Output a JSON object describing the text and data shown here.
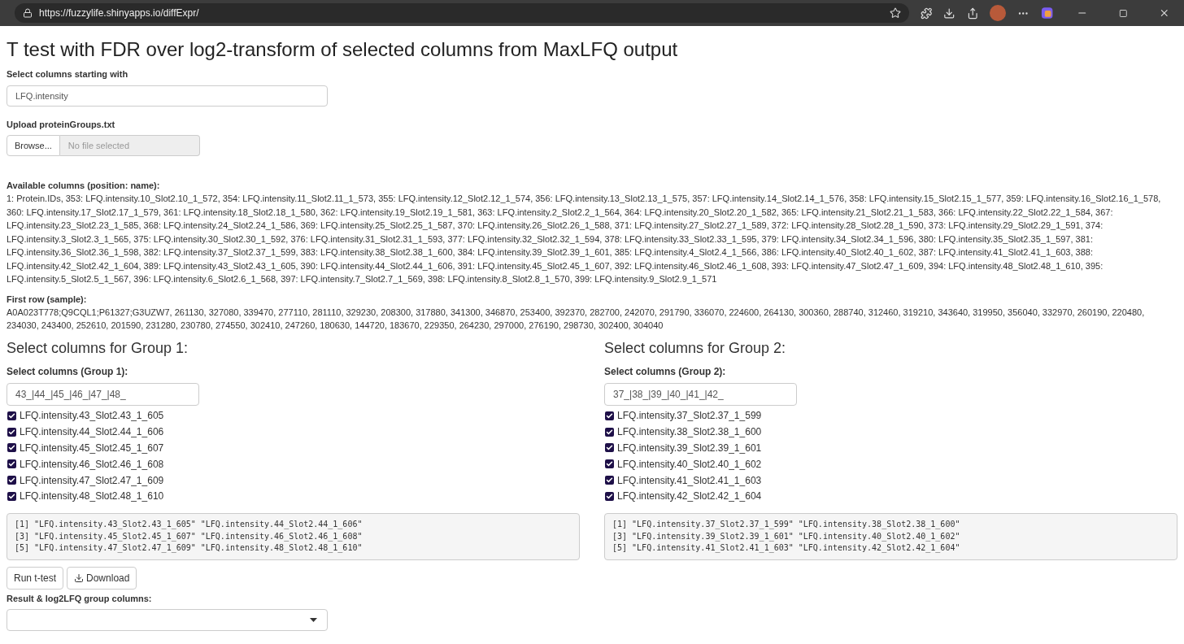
{
  "browser": {
    "url": "https://fuzzylife.shinyapps.io/diffExpr/"
  },
  "title": "T test with FDR over log2-transform of selected columns from MaxLFQ output",
  "prefix_field": {
    "label": "Select columns starting with",
    "value": "LFQ.intensity"
  },
  "upload": {
    "label": "Upload proteinGroups.txt",
    "button": "Browse...",
    "placeholder": "No file selected"
  },
  "available": {
    "heading": "Available columns (position: name):",
    "text": "1: Protein.IDs, 353: LFQ.intensity.10_Slot2.10_1_572, 354: LFQ.intensity.11_Slot2.11_1_573, 355: LFQ.intensity.12_Slot2.12_1_574, 356: LFQ.intensity.13_Slot2.13_1_575, 357: LFQ.intensity.14_Slot2.14_1_576, 358: LFQ.intensity.15_Slot2.15_1_577, 359: LFQ.intensity.16_Slot2.16_1_578, 360: LFQ.intensity.17_Slot2.17_1_579, 361: LFQ.intensity.18_Slot2.18_1_580, 362: LFQ.intensity.19_Slot2.19_1_581, 363: LFQ.intensity.2_Slot2.2_1_564, 364: LFQ.intensity.20_Slot2.20_1_582, 365: LFQ.intensity.21_Slot2.21_1_583, 366: LFQ.intensity.22_Slot2.22_1_584, 367: LFQ.intensity.23_Slot2.23_1_585, 368: LFQ.intensity.24_Slot2.24_1_586, 369: LFQ.intensity.25_Slot2.25_1_587, 370: LFQ.intensity.26_Slot2.26_1_588, 371: LFQ.intensity.27_Slot2.27_1_589, 372: LFQ.intensity.28_Slot2.28_1_590, 373: LFQ.intensity.29_Slot2.29_1_591, 374: LFQ.intensity.3_Slot2.3_1_565, 375: LFQ.intensity.30_Slot2.30_1_592, 376: LFQ.intensity.31_Slot2.31_1_593, 377: LFQ.intensity.32_Slot2.32_1_594, 378: LFQ.intensity.33_Slot2.33_1_595, 379: LFQ.intensity.34_Slot2.34_1_596, 380: LFQ.intensity.35_Slot2.35_1_597, 381: LFQ.intensity.36_Slot2.36_1_598, 382: LFQ.intensity.37_Slot2.37_1_599, 383: LFQ.intensity.38_Slot2.38_1_600, 384: LFQ.intensity.39_Slot2.39_1_601, 385: LFQ.intensity.4_Slot2.4_1_566, 386: LFQ.intensity.40_Slot2.40_1_602, 387: LFQ.intensity.41_Slot2.41_1_603, 388: LFQ.intensity.42_Slot2.42_1_604, 389: LFQ.intensity.43_Slot2.43_1_605, 390: LFQ.intensity.44_Slot2.44_1_606, 391: LFQ.intensity.45_Slot2.45_1_607, 392: LFQ.intensity.46_Slot2.46_1_608, 393: LFQ.intensity.47_Slot2.47_1_609, 394: LFQ.intensity.48_Slot2.48_1_610, 395: LFQ.intensity.5_Slot2.5_1_567, 396: LFQ.intensity.6_Slot2.6_1_568, 397: LFQ.intensity.7_Slot2.7_1_569, 398: LFQ.intensity.8_Slot2.8_1_570, 399: LFQ.intensity.9_Slot2.9_1_571"
  },
  "first_row": {
    "heading": "First row (sample):",
    "text": "A0A023T778;Q9CQL1;P61327;G3UZW7, 261130, 327080, 339470, 277110, 281110, 329230, 208300, 317880, 341300, 346870, 253400, 392370, 282700, 242070, 291790, 336070, 224600, 264130, 300360, 288740, 312460, 319210, 343640, 319950, 356040, 332970, 260190, 220480, 234030, 243400, 252610, 201590, 231280, 230780, 274550, 302410, 247260, 180630, 144720, 183670, 229350, 264230, 297000, 276190, 298730, 302400, 304040"
  },
  "groups": [
    {
      "heading": "Select columns for Group 1:",
      "label": "Select columns (Group 1):",
      "value": "43_|44_|45_|46_|47_|48_",
      "options": [
        {
          "label": "LFQ.intensity.43_Slot2.43_1_605",
          "checked": true
        },
        {
          "label": "LFQ.intensity.44_Slot2.44_1_606",
          "checked": true
        },
        {
          "label": "LFQ.intensity.45_Slot2.45_1_607",
          "checked": true
        },
        {
          "label": "LFQ.intensity.46_Slot2.46_1_608",
          "checked": true
        },
        {
          "label": "LFQ.intensity.47_Slot2.47_1_609",
          "checked": true
        },
        {
          "label": "LFQ.intensity.48_Slot2.48_1_610",
          "checked": true
        }
      ],
      "output": [
        "[1] \"LFQ.intensity.43_Slot2.43_1_605\" \"LFQ.intensity.44_Slot2.44_1_606\"",
        "[3] \"LFQ.intensity.45_Slot2.45_1_607\" \"LFQ.intensity.46_Slot2.46_1_608\"",
        "[5] \"LFQ.intensity.47_Slot2.47_1_609\" \"LFQ.intensity.48_Slot2.48_1_610\""
      ]
    },
    {
      "heading": "Select columns for Group 2:",
      "label": "Select columns (Group 2):",
      "value": "37_|38_|39_|40_|41_|42_",
      "options": [
        {
          "label": "LFQ.intensity.37_Slot2.37_1_599",
          "checked": true
        },
        {
          "label": "LFQ.intensity.38_Slot2.38_1_600",
          "checked": true
        },
        {
          "label": "LFQ.intensity.39_Slot2.39_1_601",
          "checked": true
        },
        {
          "label": "LFQ.intensity.40_Slot2.40_1_602",
          "checked": true
        },
        {
          "label": "LFQ.intensity.41_Slot2.41_1_603",
          "checked": true
        },
        {
          "label": "LFQ.intensity.42_Slot2.42_1_604",
          "checked": true
        }
      ],
      "output": [
        "[1] \"LFQ.intensity.37_Slot2.37_1_599\" \"LFQ.intensity.38_Slot2.38_1_600\"",
        "[3] \"LFQ.intensity.39_Slot2.39_1_601\" \"LFQ.intensity.40_Slot2.40_1_602\"",
        "[5] \"LFQ.intensity.41_Slot2.41_1_603\" \"LFQ.intensity.42_Slot2.42_1_604\""
      ]
    }
  ],
  "actions": {
    "run": "Run t-test",
    "download": "Download"
  },
  "result": {
    "label": "Result & log2LFQ group columns:"
  }
}
